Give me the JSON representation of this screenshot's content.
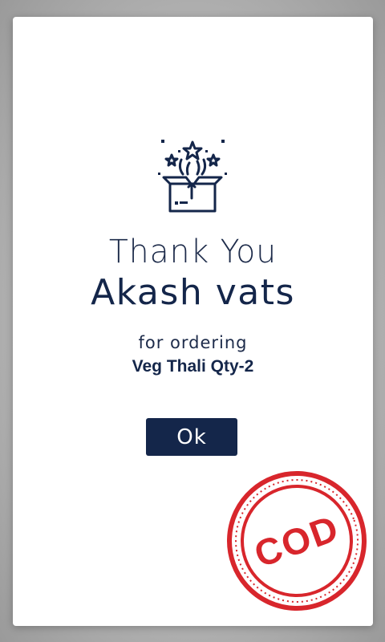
{
  "dialog": {
    "heading": "Thank You",
    "customer_name": "Akash vats",
    "ordering_label": "for ordering",
    "order_item": "Veg Thali Qty-2",
    "ok_label": "Ok",
    "stamp_text": "COD"
  },
  "icons": {
    "celebration": "gift-box-with-fireworks-icon",
    "stamp": "cod-stamp"
  },
  "colors": {
    "primary": "#14264a",
    "stamp": "#d8262c",
    "card": "#ffffff"
  }
}
